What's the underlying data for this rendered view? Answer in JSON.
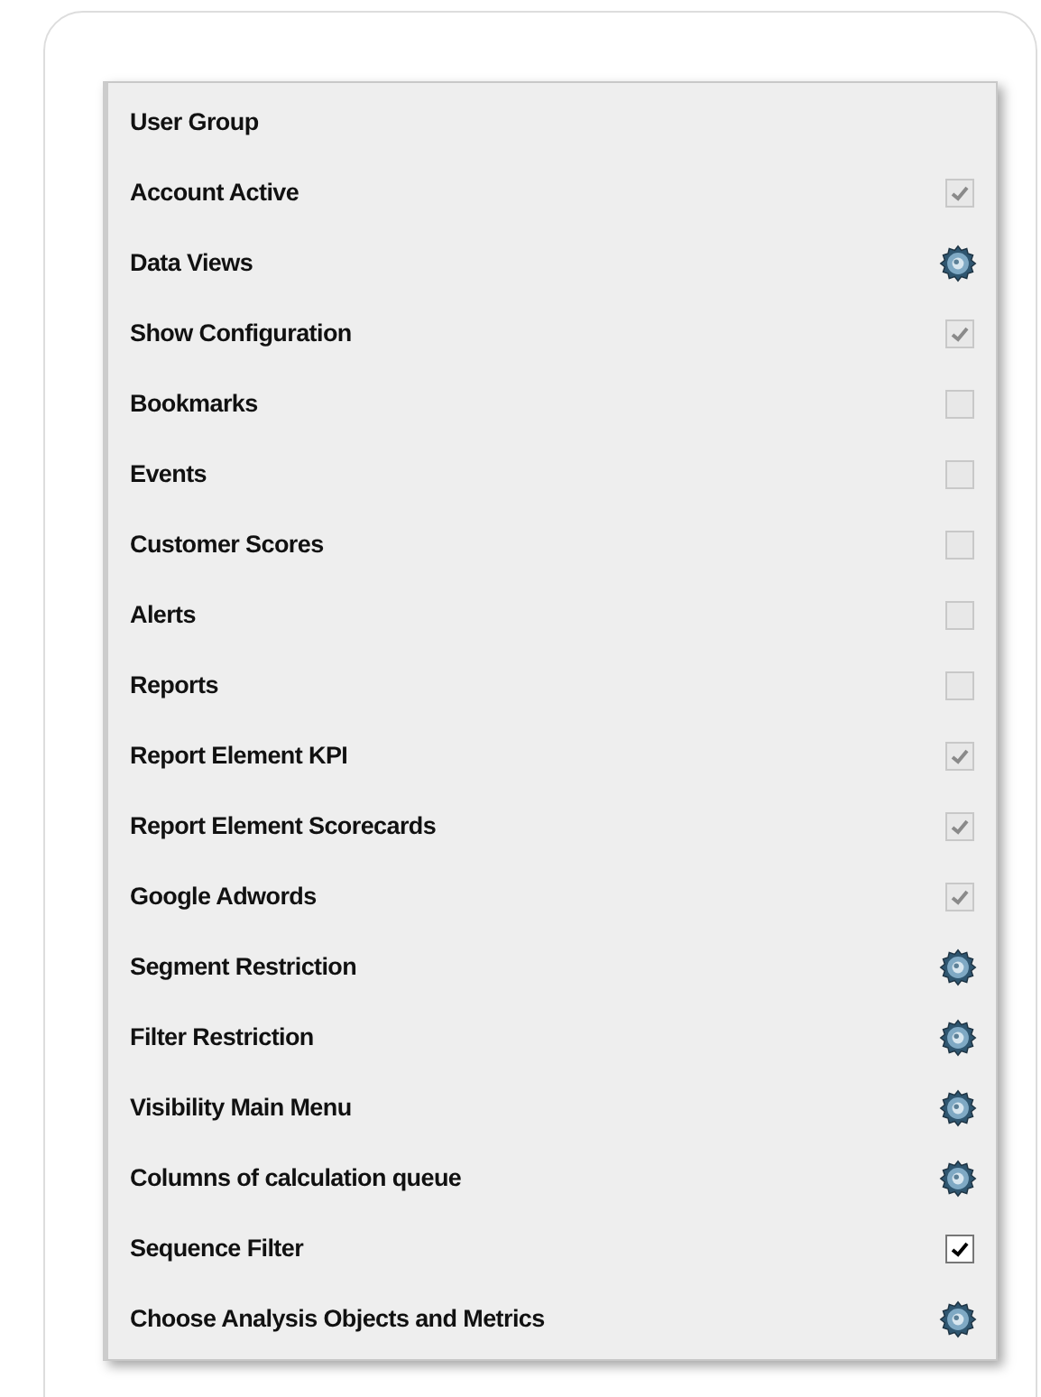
{
  "rows": [
    {
      "label": "User Group",
      "kind": "heading"
    },
    {
      "label": "Account Active",
      "kind": "checkbox",
      "checked": true,
      "disabled": true
    },
    {
      "label": "Data Views",
      "kind": "settings"
    },
    {
      "label": "Show Configuration",
      "kind": "checkbox",
      "checked": true,
      "disabled": true
    },
    {
      "label": "Bookmarks",
      "kind": "checkbox",
      "checked": false,
      "disabled": true
    },
    {
      "label": "Events",
      "kind": "checkbox",
      "checked": false,
      "disabled": true
    },
    {
      "label": "Customer Scores",
      "kind": "checkbox",
      "checked": false,
      "disabled": true
    },
    {
      "label": "Alerts",
      "kind": "checkbox",
      "checked": false,
      "disabled": true
    },
    {
      "label": "Reports",
      "kind": "checkbox",
      "checked": false,
      "disabled": true
    },
    {
      "label": "Report Element KPI",
      "kind": "checkbox",
      "checked": true,
      "disabled": true
    },
    {
      "label": "Report Element Scorecards",
      "kind": "checkbox",
      "checked": true,
      "disabled": true
    },
    {
      "label": "Google Adwords",
      "kind": "checkbox",
      "checked": true,
      "disabled": true
    },
    {
      "label": "Segment Restriction",
      "kind": "settings"
    },
    {
      "label": "Filter Restriction",
      "kind": "settings"
    },
    {
      "label": "Visibility Main Menu",
      "kind": "settings"
    },
    {
      "label": "Columns of calculation queue",
      "kind": "settings"
    },
    {
      "label": "Sequence Filter",
      "kind": "checkbox",
      "checked": true,
      "disabled": false
    },
    {
      "label": "Choose Analysis Objects and Metrics",
      "kind": "settings"
    }
  ]
}
